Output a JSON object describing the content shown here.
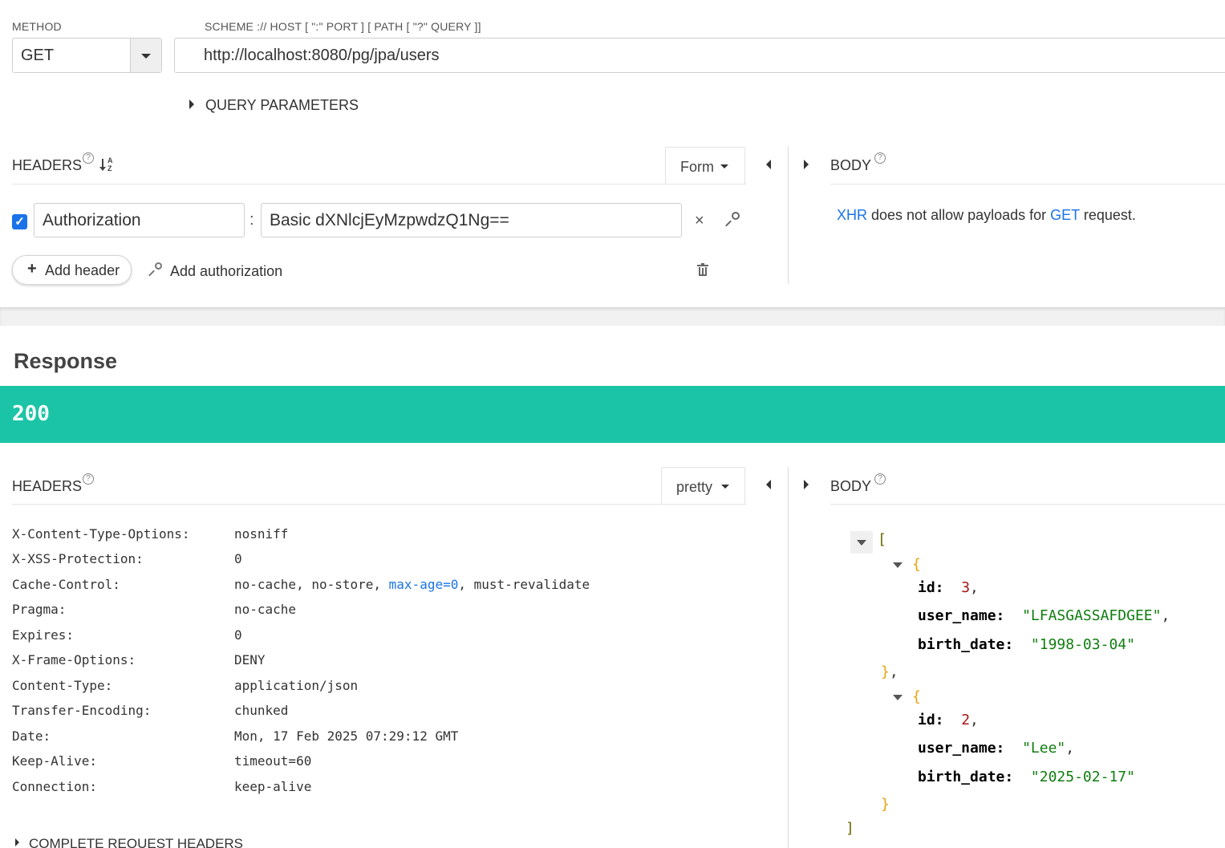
{
  "request": {
    "method_label": "METHOD",
    "method_value": "GET",
    "url_label": "SCHEME :// HOST [ \":\" PORT ] [ PATH [ \"?\" QUERY ]]",
    "url_value": "http://localhost:8080/pg/jpa/users",
    "query_parameters_label": "QUERY PARAMETERS",
    "headers_title": "HEADERS",
    "headers_mode": "Form",
    "body_title": "BODY",
    "body_message": {
      "xhr": "XHR",
      "middle": " does not allow payloads for ",
      "method": "GET",
      "end": " request."
    },
    "header_rows": [
      {
        "name": "Authorization",
        "value": "Basic dXNlcjEyMzpwdzQ1Ng==",
        "checked": true
      }
    ],
    "add_header_label": "Add header",
    "add_authorization_label": "Add authorization"
  },
  "response": {
    "title": "Response",
    "status_code": "200",
    "status_color": "#1bc4a6",
    "headers_title": "HEADERS",
    "headers_mode": "pretty",
    "body_title": "BODY",
    "headers": [
      {
        "name": "X-Content-Type-Options:",
        "value": "nosniff"
      },
      {
        "name": "X-XSS-Protection:",
        "value": "0"
      },
      {
        "name": "Cache-Control:",
        "value_parts": [
          "no-cache, no-store, ",
          "max-age=0",
          ", must-revalidate"
        ]
      },
      {
        "name": "Pragma:",
        "value": "no-cache"
      },
      {
        "name": "Expires:",
        "value": "0"
      },
      {
        "name": "X-Frame-Options:",
        "value": "DENY"
      },
      {
        "name": "Content-Type:",
        "value": "application/json"
      },
      {
        "name": "Transfer-Encoding:",
        "value": "chunked"
      },
      {
        "name": "Date:",
        "value": "Mon, 17 Feb 2025 07:29:12 GMT"
      },
      {
        "name": "Keep-Alive:",
        "value": "timeout=60"
      },
      {
        "name": "Connection:",
        "value": "keep-alive"
      }
    ],
    "complete_request_headers_label": "COMPLETE REQUEST HEADERS",
    "body": [
      {
        "id": "3",
        "user_name": "\"LFASGASSAFDGEE\"",
        "birth_date": "\"1998-03-04\""
      },
      {
        "id": "2",
        "user_name": "\"Lee\"",
        "birth_date": "\"2025-02-17\""
      }
    ],
    "json_keys": {
      "id": "id:",
      "user_name": "user_name:",
      "birth_date": "birth_date:"
    }
  }
}
